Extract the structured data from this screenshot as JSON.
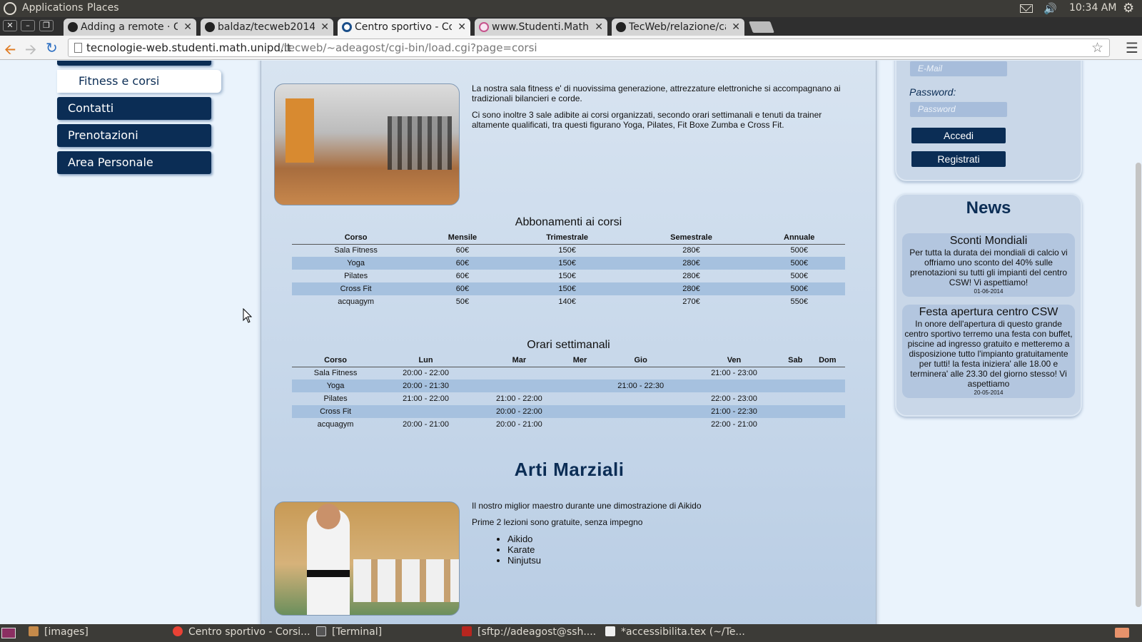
{
  "system_panel": {
    "menu_applications": "Applications",
    "menu_places": "Places",
    "clock": "10:34 AM",
    "icons": [
      "ubuntu-logo",
      "mail-icon",
      "volume-icon",
      "gear-icon"
    ]
  },
  "browser": {
    "tabs": [
      {
        "title": "Adding a remote · Git",
        "favicon": "github-icon"
      },
      {
        "title": "baldaz/tecweb2014 · ",
        "favicon": "github-icon"
      },
      {
        "title": "Centro sportivo - Cors",
        "favicon": "csw-icon",
        "active": true
      },
      {
        "title": "www.Studenti.Math.U",
        "favicon": "math-icon"
      },
      {
        "title": "TecWeb/relazione/ca",
        "favicon": "github-icon"
      }
    ],
    "url_host": "tecnologie-web.studenti.math.unipd.it",
    "url_path": "/tecweb/~adeagost/cgi-bin/load.cgi?page=corsi"
  },
  "nav": {
    "items": [
      {
        "label": "Fitness e corsi",
        "active": true
      },
      {
        "label": "Contatti"
      },
      {
        "label": "Prenotazioni"
      },
      {
        "label": "Area Personale"
      }
    ]
  },
  "fitness": {
    "paragraph1": "La nostra sala fitness e' di nuovissima generazione, attrezzature elettroniche si accompagnano ai tradizionali bilancieri e corde.",
    "paragraph2": "Ci sono inoltre 3 sale adibite ai corsi organizzati, secondo orari settimanali e tenuti da trainer altamente qualificati, tra questi figurano Yoga, Pilates, Fit Boxe Zumba e Cross Fit."
  },
  "subscriptions": {
    "title": "Abbonamenti ai corsi",
    "headers": [
      "Corso",
      "Mensile",
      "Trimestrale",
      "Semestrale",
      "Annuale"
    ],
    "rows": [
      [
        "Sala Fitness",
        "60€",
        "150€",
        "280€",
        "500€"
      ],
      [
        "Yoga",
        "60€",
        "150€",
        "280€",
        "500€"
      ],
      [
        "Pilates",
        "60€",
        "150€",
        "280€",
        "500€"
      ],
      [
        "Cross Fit",
        "60€",
        "150€",
        "280€",
        "500€"
      ],
      [
        "acquagym",
        "50€",
        "140€",
        "270€",
        "550€"
      ]
    ]
  },
  "schedule": {
    "title": "Orari settimanali",
    "headers": [
      "Corso",
      "Lun",
      "Mar",
      "Mer",
      "Gio",
      "Ven",
      "Sab",
      "Dom"
    ],
    "rows": [
      [
        "Sala Fitness",
        "20:00 - 22:00",
        "",
        "",
        "",
        "21:00 - 23:00",
        "",
        ""
      ],
      [
        "Yoga",
        "20:00 - 21:30",
        "",
        "",
        "21:00 - 22:30",
        "",
        "",
        ""
      ],
      [
        "Pilates",
        "21:00 - 22:00",
        "21:00 - 22:00",
        "",
        "",
        "22:00 - 23:00",
        "",
        ""
      ],
      [
        "Cross Fit",
        "",
        "20:00 - 22:00",
        "",
        "",
        "21:00 - 22:30",
        "",
        ""
      ],
      [
        "acquagym",
        "20:00 - 21:00",
        "20:00 - 21:00",
        "",
        "",
        "22:00 - 21:00",
        "",
        ""
      ]
    ]
  },
  "martial": {
    "title": "Arti Marziali",
    "paragraph1": "Il nostro miglior maestro durante une dimostrazione di Aikido",
    "paragraph2": "Prime 2 lezioni sono gratuite, senza impegno",
    "list": [
      "Aikido",
      "Karate",
      "Ninjutsu"
    ]
  },
  "login": {
    "email_placeholder": "E-Mail",
    "password_label": "Password:",
    "password_placeholder": "Password",
    "login_button": "Accedi",
    "register_button": "Registrati"
  },
  "news": {
    "title": "News",
    "items": [
      {
        "title": "Sconti Mondiali",
        "body": "Per tutta la durata dei mondiali di calcio vi offriamo uno sconto del 40% sulle prenotazioni su tutti gli impianti del centro CSW! Vi aspettiamo!",
        "date": "01-06-2014"
      },
      {
        "title": "Festa apertura centro CSW",
        "body": "In onore dell'apertura di questo grande centro sportivo terremo una festa con buffet, piscine ad ingresso gratuito e metteremo a disposizione tutto l'impianto gratuitamente per tutti! la festa iniziera' alle 18.00 e terminera' alle 23.30 del giorno stesso! Vi aspettiamo",
        "date": "20-05-2014"
      }
    ]
  },
  "taskbar": {
    "tasks": [
      "[images]",
      "Centro sportivo - Corsi...",
      "[Terminal]",
      "[sftp://adeagost@ssh....",
      "*accessibilita.tex (~/Te..."
    ]
  }
}
